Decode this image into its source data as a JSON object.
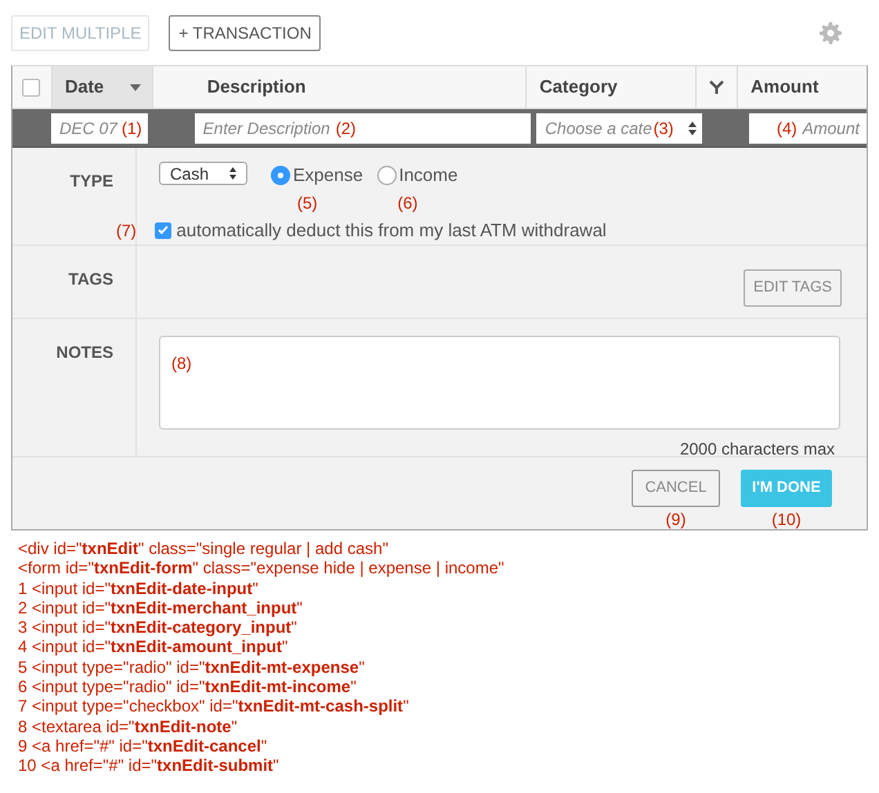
{
  "toolbar": {
    "edit_multiple": {
      "label": "EDIT MULTIPLE",
      "disabled": true
    },
    "add_transaction": {
      "label": "+ TRANSACTION"
    }
  },
  "table": {
    "select_all_checked": false,
    "columns": [
      {
        "label": "Date",
        "sorted": true
      },
      {
        "label": "Description",
        "sorted": false
      },
      {
        "label": "Category",
        "sorted": false
      },
      {
        "label": "Amount",
        "sorted": false
      }
    ]
  },
  "edit_row": {
    "date": {
      "value": "DEC 07",
      "marker": "(1)"
    },
    "description": {
      "placeholder": "Enter Description",
      "marker": "(2)"
    },
    "category": {
      "value": "Choose a cate",
      "marker": "(3)"
    },
    "amount": {
      "placeholder": "Amount",
      "marker": "(4)"
    }
  },
  "type_section": {
    "label": "TYPE",
    "account": "Cash",
    "options": [
      {
        "label": "Expense",
        "selected": true,
        "marker": "(5)"
      },
      {
        "label": "Income",
        "selected": false,
        "marker": "(6)"
      }
    ],
    "deduct": {
      "label": "automatically deduct this from my last ATM withdrawal",
      "checked": true,
      "marker": "(7)"
    }
  },
  "tags_section": {
    "label": "TAGS",
    "button": "EDIT TAGS"
  },
  "notes_section": {
    "label": "NOTES",
    "marker": "(8)",
    "limit": "2000 characters max"
  },
  "footer": {
    "cancel": {
      "label": "CANCEL",
      "marker": "(9)"
    },
    "done": {
      "label": "I'M DONE",
      "marker": "(10)"
    }
  },
  "code_lines": [
    "<div id=\"**txnEdit**\" class=\"single regular | add cash\"",
    "<form id=\"**txnEdit-form**\" class=\"expense hide | expense | income\"",
    "1 <input id=\"**txnEdit-date-input**\"",
    "2 <input id=\"**txnEdit-merchant_input**\"",
    "3 <input id=\"**txnEdit-category_input**\"",
    "4 <input id=\"**txnEdit-amount_input**\"",
    "5 <input type=\"radio\" id=\"**txnEdit-mt-expense**\"",
    "6 <input type=\"radio\" id=\"**txnEdit-mt-income**\"",
    "7 <input type=\"checkbox\" id=\"**txnEdit-mt-cash-split**\"",
    "8 <textarea id=\"**txnEdit-note**\"",
    "9 <a href=\"#\" id=\"**txnEdit-cancel**\"",
    "10 <a href=\"#\" id=\"**txnEdit-submit**\""
  ]
}
